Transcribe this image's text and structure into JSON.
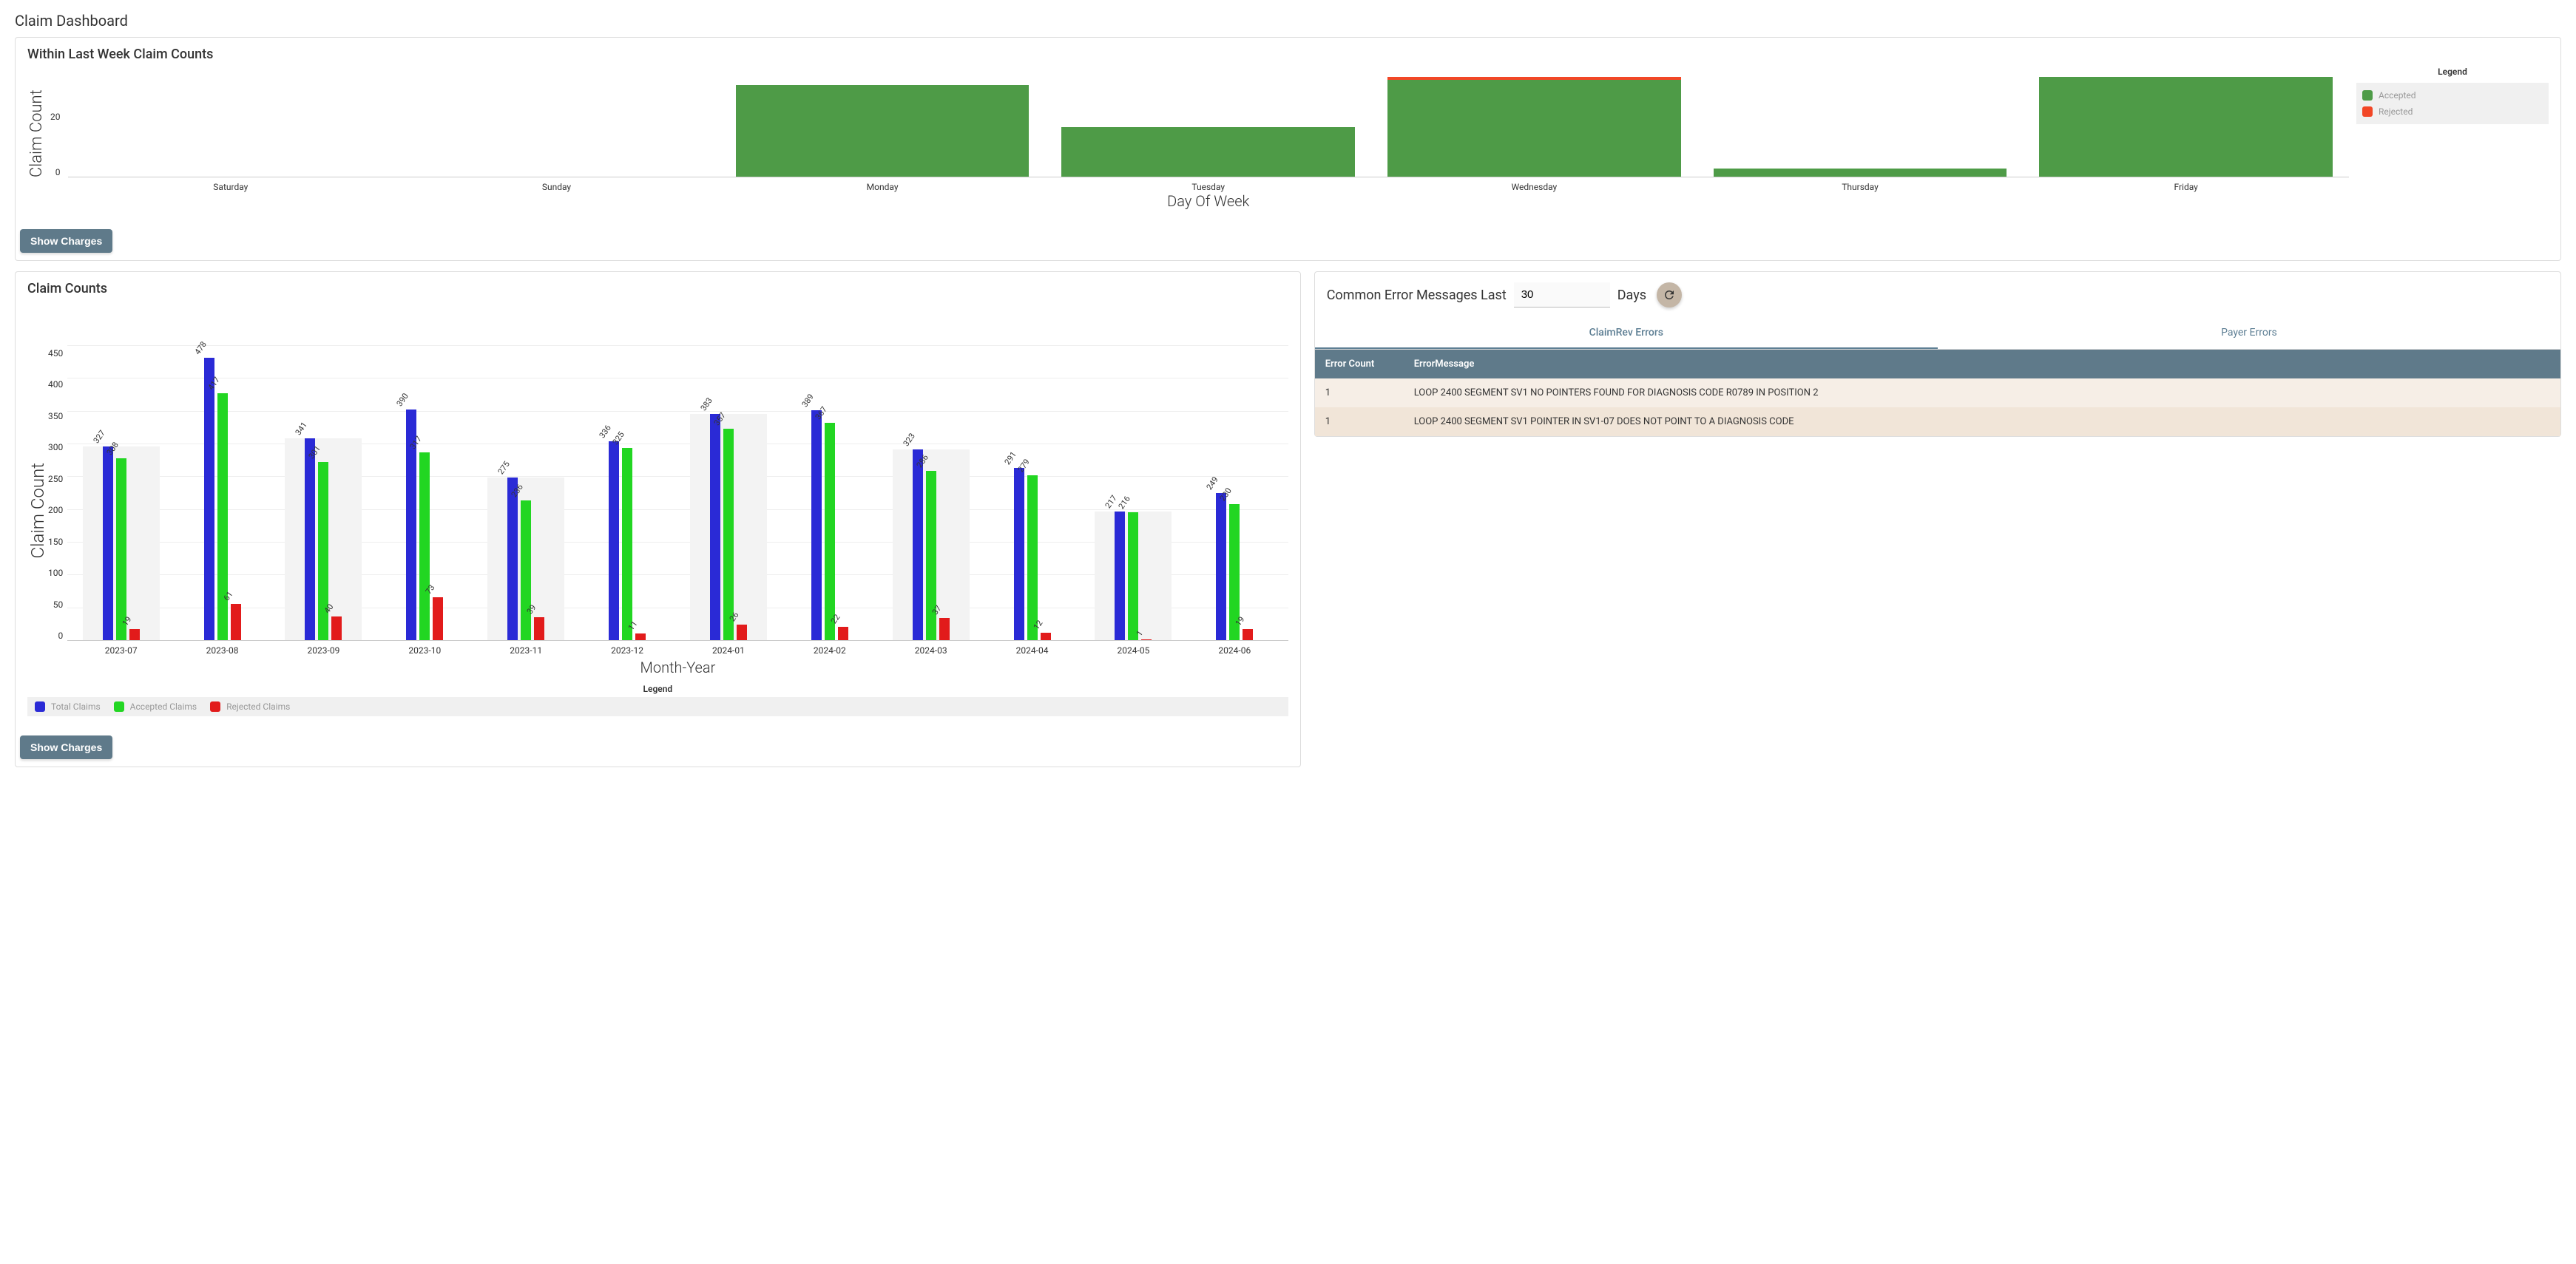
{
  "page": {
    "title": "Claim Dashboard"
  },
  "weekly_panel": {
    "title": "Within Last Week Claim Counts",
    "show_charges_btn": "Show Charges",
    "legend_title": "Legend",
    "legend_accepted": "Accepted",
    "legend_rejected": "Rejected",
    "ylabel": "Claim Count",
    "xlabel": "Day Of Week",
    "ytick_top": "20",
    "ytick_bottom": "0"
  },
  "monthly_panel": {
    "title": "Claim Counts",
    "show_charges_btn": "Show Charges",
    "ylabel": "Claim Count",
    "xlabel": "Month-Year",
    "legend_title": "Legend",
    "legend_total": "Total Claims",
    "legend_accepted": "Accepted Claims",
    "legend_rejected": "Rejected Claims"
  },
  "errors_panel": {
    "prefix": "Common Error Messages Last",
    "days_value": "30",
    "suffix": "Days",
    "tab_claimrev": "ClaimRev Errors",
    "tab_payer": "Payer Errors",
    "col_count": "Error Count",
    "col_msg": "ErrorMessage",
    "rows": [
      {
        "count": "1",
        "msg": "LOOP 2400 SEGMENT SV1 NO POINTERS FOUND FOR DIAGNOSIS CODE R0789 IN POSITION 2"
      },
      {
        "count": "1",
        "msg": "LOOP 2400 SEGMENT SV1 POINTER IN SV1-07 DOES NOT POINT TO A DIAGNOSIS CODE"
      }
    ]
  },
  "chart_data": [
    {
      "type": "bar",
      "title": "Within Last Week Claim Counts",
      "xlabel": "Day Of Week",
      "ylabel": "Claim Count",
      "stacked": true,
      "categories": [
        "Saturday",
        "Sunday",
        "Monday",
        "Tuesday",
        "Wednesday",
        "Thursday",
        "Friday"
      ],
      "series": [
        {
          "name": "Accepted",
          "color": "#4e9b47",
          "values": [
            0,
            0,
            33,
            18,
            35,
            3,
            36
          ]
        },
        {
          "name": "Rejected",
          "color": "#f24726",
          "values": [
            0,
            0,
            0,
            0,
            1,
            0,
            0
          ]
        }
      ],
      "yticks": [
        0,
        20
      ],
      "ylim": [
        0,
        40
      ]
    },
    {
      "type": "bar",
      "title": "Claim Counts",
      "xlabel": "Month-Year",
      "ylabel": "Claim Count",
      "categories": [
        "2023-07",
        "2023-08",
        "2023-09",
        "2023-10",
        "2023-11",
        "2023-12",
        "2024-01",
        "2024-02",
        "2024-03",
        "2024-04",
        "2024-05",
        "2024-06"
      ],
      "series": [
        {
          "name": "Total Claims",
          "color": "#2a2ad6",
          "values": [
            327,
            478,
            341,
            390,
            275,
            336,
            383,
            389,
            323,
            291,
            217,
            249
          ]
        },
        {
          "name": "Accepted Claims",
          "color": "#22d622",
          "values": [
            308,
            417,
            301,
            317,
            236,
            325,
            357,
            367,
            286,
            279,
            216,
            230
          ]
        },
        {
          "name": "Rejected Claims",
          "color": "#e21b1b",
          "values": [
            19,
            61,
            40,
            73,
            39,
            11,
            26,
            22,
            37,
            12,
            1,
            19
          ]
        }
      ],
      "yticks": [
        0,
        50,
        100,
        150,
        200,
        250,
        300,
        350,
        400,
        450
      ],
      "ylim": [
        0,
        500
      ]
    }
  ]
}
